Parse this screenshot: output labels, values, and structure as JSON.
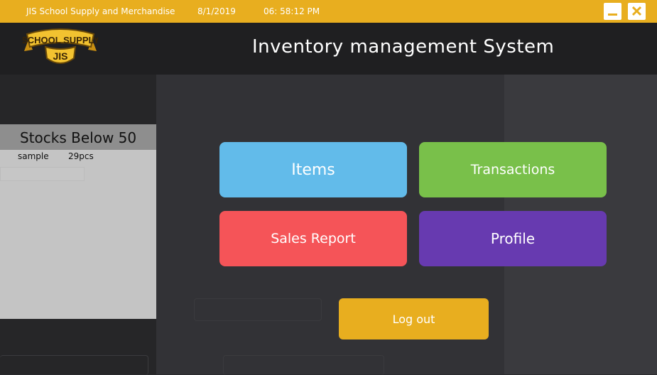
{
  "titlebar": {
    "company": "JIS School Supply and Merchandise",
    "date": "8/1/2019",
    "time": "06: 58:12 PM",
    "bg_color": "#e8ae1f"
  },
  "window_controls": {
    "minimize_icon": "minimize-icon",
    "close_icon": "close-icon"
  },
  "header": {
    "title": "Inventory management System",
    "logo": {
      "line1": "SCHOOL SUPPLY",
      "line2": "JIS"
    }
  },
  "stocks_panel": {
    "title": "Stocks Below 50",
    "items": [
      {
        "name": "sample",
        "qty": "29pcs"
      }
    ]
  },
  "menu": {
    "items": "Items",
    "transactions": "Transactions",
    "sales_report": "Sales Report",
    "profile": "Profile",
    "logout": "Log out"
  },
  "colors": {
    "items": "#62bbea",
    "transactions": "#79c04a",
    "sales_report": "#f55458",
    "profile": "#673ab0",
    "logout": "#e8ae1f"
  }
}
